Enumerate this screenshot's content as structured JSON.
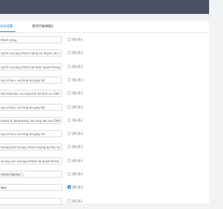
{
  "tabs": [
    {
      "label": "协议设置",
      "active": true
    },
    {
      "label": "借贷代收弹框设置",
      "active": false
    }
  ],
  "checkbox_label": "提示显示",
  "rows": [
    {
      "text": "thành công.",
      "checked": false
    },
    {
      "text": "ng tin cua quy khach dang voi duyet, xin vui long",
      "checked": false
    },
    {
      "text": "ng tin cua quy khach da duoc duyet thong qua.",
      "checked": false
    },
    {
      "text": "ng rut tien, vui long doi giay lat",
      "checked": false
    },
    {
      "text": "tien that bai, vui long lien he dich vu CSKH truc t",
      "checked": false
    },
    {
      "text": "ng rut tien, vui long doi giay lat",
      "checked": false
    },
    {
      "text": "khoan bi dong bang. Vui long lien he CSKH.",
      "checked": false
    },
    {
      "text": "ng rut tien, vui long doi giay lat",
      "checked": false
    },
    {
      "text": "thong tanh trả quy khach khong du tha nang than",
      "checked": false
    },
    {
      "text": "so vay von cua quy khach da duyet thanh cong, tr",
      "checked": false
    },
    {
      "text": "的的账号被冻结了。",
      "checked": false
    },
    {
      "text": "审核",
      "checked": true
    },
    {
      "text": "",
      "checked": false
    }
  ],
  "colors": {
    "accent": "#1e88e5",
    "topbar": "#4a5064"
  }
}
